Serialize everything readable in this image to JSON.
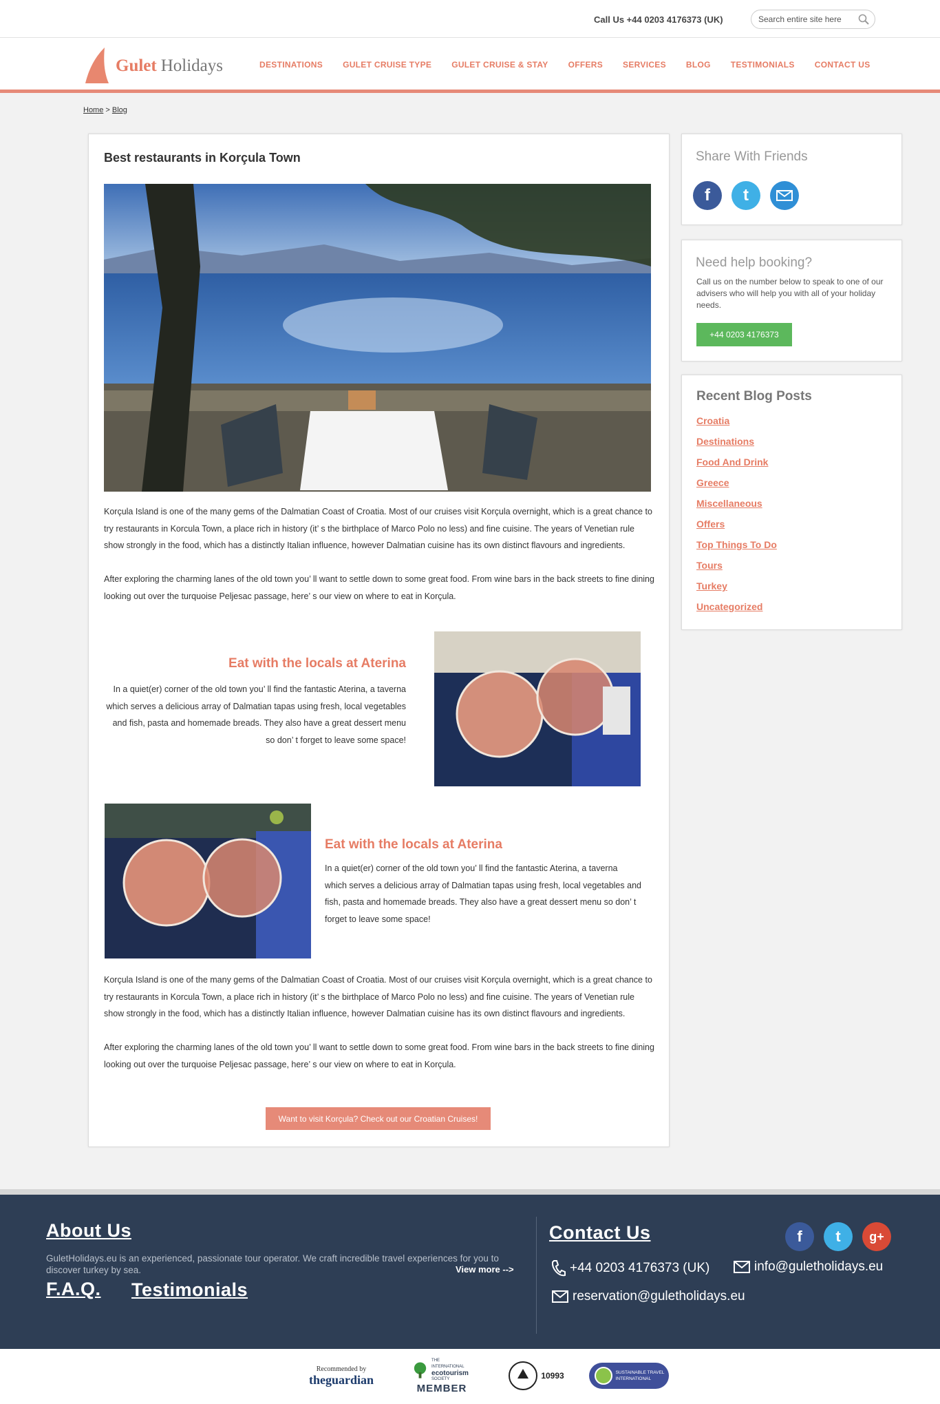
{
  "header": {
    "call_text": "Call Us +44 0203 4176373 (UK)",
    "search_placeholder": "Search entire site here"
  },
  "logo": {
    "word1": "Gulet",
    "word2": "Holidays"
  },
  "nav": [
    "DESTINATIONS",
    "GULET CRUISE TYPE",
    "GULET CRUISE & STAY",
    "OFFERS",
    "SERVICES",
    "BLOG",
    "TESTIMONIALS",
    "CONTACT US"
  ],
  "breadcrumb": {
    "home": "Home",
    "sep": " > ",
    "current": "Blog"
  },
  "article": {
    "title": "Best restaurants in Korçula Town",
    "intro_p1": "Korçula Island is one of the many gems of the Dalmatian Coast of Croatia. Most of our cruises visit Korçula overnight, which is a great chance to try restaurants in Korcula Town, a place rich in history (it’ s the birthplace of Marco Polo no less) and fine cuisine. The years of Venetian rule show strongly in the food, which has a distinctly Italian influence, however Dalmatian cuisine has its own distinct flavours and ingredients.",
    "intro_p2": "After exploring the charming lanes of the old town you’ ll want to settle down to some great food. From wine bars in the back streets to fine dining looking out over the turquoise Peljesac passage, here’ s our view on where to eat in Korçula.",
    "feature1_title": "Eat with the locals at Aterina",
    "feature1_text": "In a quiet(er) corner of the old town you’ ll find the fantastic Aterina, a taverna which serves a delicious array of Dalmatian tapas using fresh, local vegetables and fish, pasta and homemade breads. They also have a great dessert menu so don’ t forget to leave some space!",
    "feature2_title": "Eat with the locals at Aterina",
    "feature2_text": "In a quiet(er) corner of the old town you’ ll find the fantastic Aterina, a taverna which serves a delicious array of Dalmatian tapas using fresh, local vegetables and fish, pasta and homemade breads. They also have a great dessert menu so don’ t forget to leave some space!",
    "outro_p1": "Korçula Island is one of the many gems of the Dalmatian Coast of Croatia. Most of our cruises visit Korçula overnight, which is a great chance to try restaurants in Korcula Town, a place rich in history (it’ s the birthplace of Marco Polo no less) and fine cuisine. The years of Venetian rule show strongly in the food, which has a distinctly Italian influence, however Dalmatian cuisine has its own distinct flavours and ingredients.",
    "outro_p2": "After exploring the charming lanes of the old town you’ ll want to settle down to some great food. From wine bars in the back streets to fine dining looking out over the turquoise Peljesac passage, here’ s our view on where to eat in Korçula.",
    "cta": "Want to visit Korçula? Check out our Croatian Cruises!"
  },
  "sidebar": {
    "share_title": "Share With Friends",
    "share_icons": [
      "facebook-icon",
      "twitter-icon",
      "email-icon"
    ],
    "help_title": "Need help booking?",
    "help_text": "Call us on the number below to speak to one of our advisers who will help you with all of your holiday needs.",
    "help_phone": "+44 0203 4176373",
    "recent_title": "Recent Blog Posts",
    "recent_posts": [
      "Croatia",
      "Destinations",
      "Food And Drink",
      "Greece",
      "Miscellaneous",
      "Offers",
      "Top Things To Do",
      "Tours",
      "Turkey",
      "Uncategorized"
    ]
  },
  "footer": {
    "about_title": "About Us",
    "about_text": "GuletHolidays.eu is an experienced, passionate tour operator. We craft incredible travel experiences for you to discover turkey by sea.",
    "view_more": "View more -->",
    "faq": "F.A.Q.",
    "testimonials": "Testimonials",
    "contact_title": "Contact Us",
    "phone": "+44 0203 4176373 (UK)",
    "email_info": "info@guletholidays.eu",
    "email_reservation": "reservation@guletholidays.eu"
  },
  "partners": {
    "guardian_top": "Recommended by",
    "guardian_name": "theguardian",
    "ecotourism_line1": "THE INTERNATIONAL",
    "ecotourism_line2": "ecotourism",
    "ecotourism_line3": "SOCIETY",
    "ecotourism_member": "MEMBER",
    "abta_number": "10993",
    "sti_line1": "SUSTAINABLE TRAVEL",
    "sti_line2": "INTERNATIONAL"
  },
  "colors": {
    "accent": "#e67c64",
    "footer_bg": "#2e3e55",
    "help_button": "#5cb85c"
  }
}
